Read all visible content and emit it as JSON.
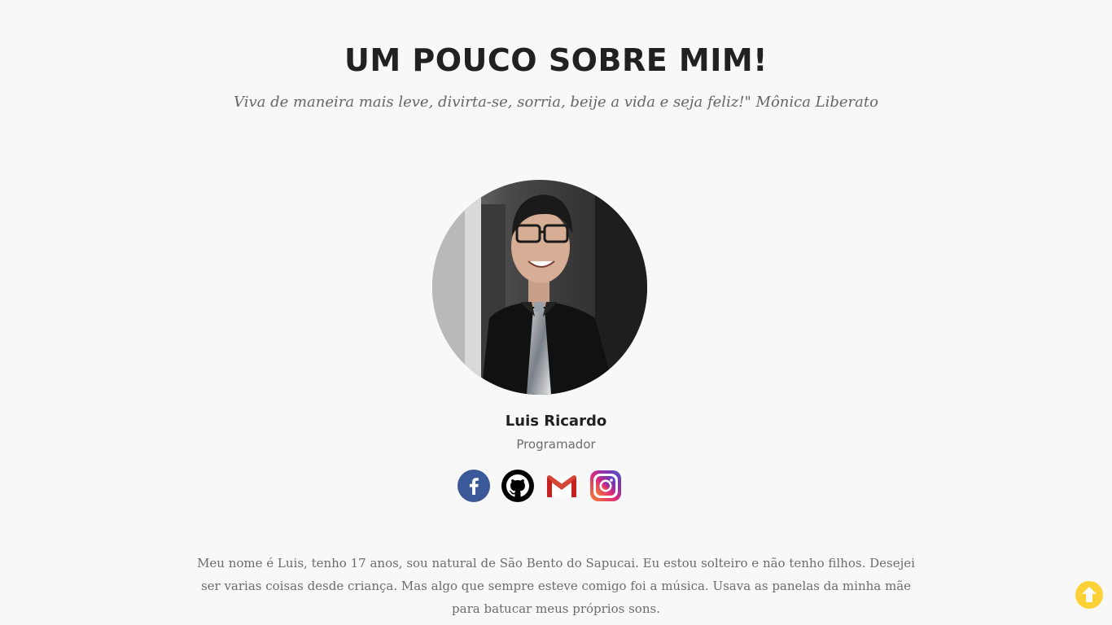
{
  "about": {
    "heading": "UM POUCO SOBRE MIM!",
    "quote": "Viva de maneira mais leve, divirta-se, sorria, beije a vida e seja feliz!\" Mônica Liberato"
  },
  "profile": {
    "name": "Luis Ricardo",
    "role": "Programador",
    "photo": "profile-photo"
  },
  "social": [
    {
      "name": "facebook",
      "icon": "facebook-icon",
      "color": "#3b5998"
    },
    {
      "name": "github",
      "icon": "github-icon",
      "color": "#000000"
    },
    {
      "name": "gmail",
      "icon": "gmail-icon",
      "color": "#d44638"
    },
    {
      "name": "instagram",
      "icon": "instagram-icon",
      "color": "#c13584"
    }
  ],
  "bio": {
    "text": "Meu nome é Luis, tenho 17 anos, sou natural de São Bento do Sapucai. Eu estou solteiro e não tenho filhos. Desejei ser varias coisas desde criança. Mas algo que sempre esteve comigo foi a música. Usava as panelas da minha mãe para batucar meus próprios sons."
  },
  "scroll_top": {
    "icon": "arrow-up-icon",
    "color": "#fed136"
  }
}
